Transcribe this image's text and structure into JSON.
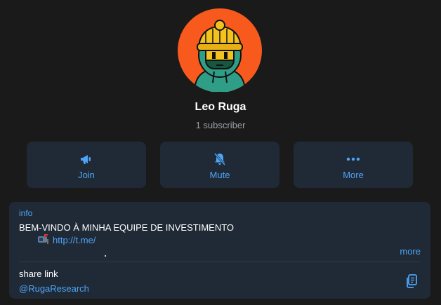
{
  "profile": {
    "name": "Leo Ruga",
    "subscribers": "1 subscriber",
    "avatar_bg": "#f85a1d"
  },
  "actions": [
    {
      "label": "Join",
      "icon": "megaphone-icon"
    },
    {
      "label": "Mute",
      "icon": "bell-muted-icon"
    },
    {
      "label": "More",
      "icon": "ellipsis-icon"
    }
  ],
  "info": {
    "label": "info",
    "text": "BEM-VINDO À MINHA EQUIPE DE INVESTIMENTO",
    "link_icon": "mailbox-icon",
    "link": "http://t.me/",
    "more": "more"
  },
  "share": {
    "label": "share link",
    "handle": "@RugaResearch",
    "copy_icon": "copy-icon"
  },
  "colors": {
    "accent": "#4ea4f6",
    "card": "#1f2a36",
    "background": "#1a1a1a"
  }
}
